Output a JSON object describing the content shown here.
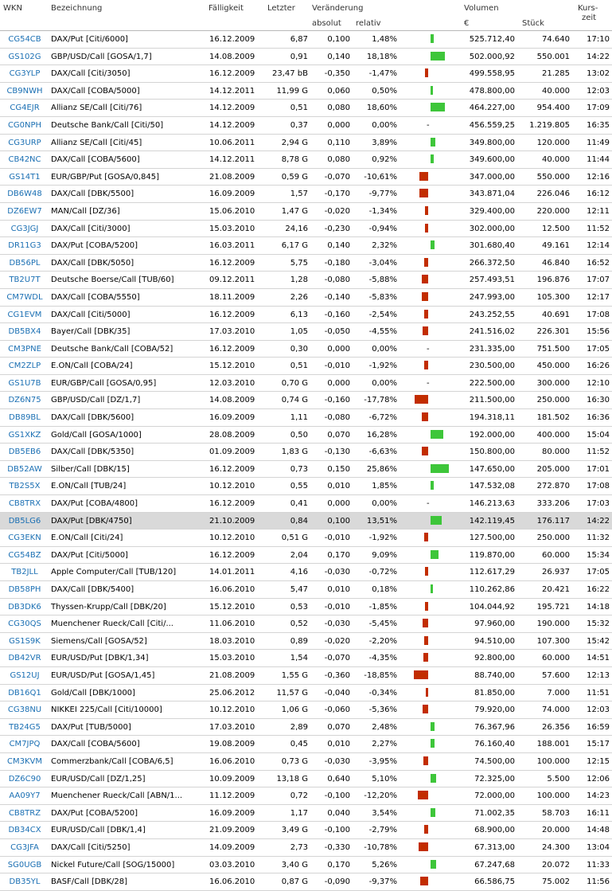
{
  "header": {
    "wkn": "WKN",
    "name": "Bezeichnung",
    "maturity": "Fälligkeit",
    "last": "Letzter",
    "change": "Veränderung",
    "absolute": "absolut",
    "relative": "relativ",
    "volume": "Volumen",
    "volume_unit": "€",
    "pieces": "Stück",
    "time_line1": "Kurs-",
    "time_line2": "zeit"
  },
  "colors": {
    "positive": "#3ec63a",
    "negative": "#c22d00",
    "link": "#1a6fb3",
    "highlight": "#d9d9d9"
  },
  "rows": [
    {
      "wkn": "CG54CB",
      "name": "DAX/Put [Citi/6000]",
      "maturity": "16.12.2009",
      "last": "6,87",
      "abs": "0,100",
      "rel": "1,48%",
      "change_pct": 1.48,
      "volume": "525.712,40",
      "qty": "74.640",
      "time": "17:10"
    },
    {
      "wkn": "GS102G",
      "name": "GBP/USD/Call [GOSA/1,7]",
      "maturity": "14.08.2009",
      "last": "0,91",
      "abs": "0,140",
      "rel": "18,18%",
      "change_pct": 18.18,
      "volume": "502.000,92",
      "qty": "550.001",
      "time": "14:22"
    },
    {
      "wkn": "CG3YLP",
      "name": "DAX/Call [Citi/3050]",
      "maturity": "16.12.2009",
      "last": "23,47 bB",
      "abs": "-0,350",
      "rel": "-1,47%",
      "change_pct": -1.47,
      "volume": "499.558,95",
      "qty": "21.285",
      "time": "13:02"
    },
    {
      "wkn": "CB9NWH",
      "name": "DAX/Call [COBA/5000]",
      "maturity": "14.12.2011",
      "last": "11,99 G",
      "abs": "0,060",
      "rel": "0,50%",
      "change_pct": 0.5,
      "volume": "478.800,00",
      "qty": "40.000",
      "time": "12:03"
    },
    {
      "wkn": "CG4EJR",
      "name": "Allianz SE/Call [Citi/76]",
      "maturity": "14.12.2009",
      "last": "0,51",
      "abs": "0,080",
      "rel": "18,60%",
      "change_pct": 18.6,
      "volume": "464.227,00",
      "qty": "954.400",
      "time": "17:09"
    },
    {
      "wkn": "CG0NPH",
      "name": "Deutsche Bank/Call [Citi/50]",
      "maturity": "14.12.2009",
      "last": "0,37",
      "abs": "0,000",
      "rel": "0,00%",
      "change_pct": 0,
      "volume": "456.559,25",
      "qty": "1.219.805",
      "time": "16:35"
    },
    {
      "wkn": "CG3URP",
      "name": "Allianz SE/Call [Citi/45]",
      "maturity": "10.06.2011",
      "last": "2,94 G",
      "abs": "0,110",
      "rel": "3,89%",
      "change_pct": 3.89,
      "volume": "349.800,00",
      "qty": "120.000",
      "time": "11:49"
    },
    {
      "wkn": "CB42NC",
      "name": "DAX/Call [COBA/5600]",
      "maturity": "14.12.2011",
      "last": "8,78 G",
      "abs": "0,080",
      "rel": "0,92%",
      "change_pct": 0.92,
      "volume": "349.600,00",
      "qty": "40.000",
      "time": "11:44"
    },
    {
      "wkn": "GS14T1",
      "name": "EUR/GBP/Put [GOSA/0,845]",
      "maturity": "21.08.2009",
      "last": "0,59 G",
      "abs": "-0,070",
      "rel": "-10,61%",
      "change_pct": -10.61,
      "volume": "347.000,00",
      "qty": "550.000",
      "time": "12:16"
    },
    {
      "wkn": "DB6W48",
      "name": "DAX/Call [DBK/5500]",
      "maturity": "16.09.2009",
      "last": "1,57",
      "abs": "-0,170",
      "rel": "-9,77%",
      "change_pct": -9.77,
      "volume": "343.871,04",
      "qty": "226.046",
      "time": "16:12"
    },
    {
      "wkn": "DZ6EW7",
      "name": "MAN/Call [DZ/36]",
      "maturity": "15.06.2010",
      "last": "1,47 G",
      "abs": "-0,020",
      "rel": "-1,34%",
      "change_pct": -1.34,
      "volume": "329.400,00",
      "qty": "220.000",
      "time": "12:11"
    },
    {
      "wkn": "CG3JGJ",
      "name": "DAX/Call [Citi/3000]",
      "maturity": "15.03.2010",
      "last": "24,16",
      "abs": "-0,230",
      "rel": "-0,94%",
      "change_pct": -0.94,
      "volume": "302.000,00",
      "qty": "12.500",
      "time": "11:52"
    },
    {
      "wkn": "DR11G3",
      "name": "DAX/Put [COBA/5200]",
      "maturity": "16.03.2011",
      "last": "6,17 G",
      "abs": "0,140",
      "rel": "2,32%",
      "change_pct": 2.32,
      "volume": "301.680,40",
      "qty": "49.161",
      "time": "12:14"
    },
    {
      "wkn": "DB56PL",
      "name": "DAX/Call [DBK/5050]",
      "maturity": "16.12.2009",
      "last": "5,75",
      "abs": "-0,180",
      "rel": "-3,04%",
      "change_pct": -3.04,
      "volume": "266.372,50",
      "qty": "46.840",
      "time": "16:52"
    },
    {
      "wkn": "TB2U7T",
      "name": "Deutsche Boerse/Call [TUB/60]",
      "maturity": "09.12.2011",
      "last": "1,28",
      "abs": "-0,080",
      "rel": "-5,88%",
      "change_pct": -5.88,
      "volume": "257.493,51",
      "qty": "196.876",
      "time": "17:07"
    },
    {
      "wkn": "CM7WDL",
      "name": "DAX/Call [COBA/5550]",
      "maturity": "18.11.2009",
      "last": "2,26",
      "abs": "-0,140",
      "rel": "-5,83%",
      "change_pct": -5.83,
      "volume": "247.993,00",
      "qty": "105.300",
      "time": "12:17"
    },
    {
      "wkn": "CG1EVM",
      "name": "DAX/Call [Citi/5000]",
      "maturity": "16.12.2009",
      "last": "6,13",
      "abs": "-0,160",
      "rel": "-2,54%",
      "change_pct": -2.54,
      "volume": "243.252,55",
      "qty": "40.691",
      "time": "17:08"
    },
    {
      "wkn": "DB5BX4",
      "name": "Bayer/Call [DBK/35]",
      "maturity": "17.03.2010",
      "last": "1,05",
      "abs": "-0,050",
      "rel": "-4,55%",
      "change_pct": -4.55,
      "volume": "241.516,02",
      "qty": "226.301",
      "time": "15:56"
    },
    {
      "wkn": "CM3PNE",
      "name": "Deutsche Bank/Call [COBA/52]",
      "maturity": "16.12.2009",
      "last": "0,30",
      "abs": "0,000",
      "rel": "0,00%",
      "change_pct": 0,
      "volume": "231.335,00",
      "qty": "751.500",
      "time": "17:05"
    },
    {
      "wkn": "CM2ZLP",
      "name": "E.ON/Call [COBA/24]",
      "maturity": "15.12.2010",
      "last": "0,51",
      "abs": "-0,010",
      "rel": "-1,92%",
      "change_pct": -1.92,
      "volume": "230.500,00",
      "qty": "450.000",
      "time": "16:26"
    },
    {
      "wkn": "GS1U7B",
      "name": "EUR/GBP/Call [GOSA/0,95]",
      "maturity": "12.03.2010",
      "last": "0,70 G",
      "abs": "0,000",
      "rel": "0,00%",
      "change_pct": 0,
      "volume": "222.500,00",
      "qty": "300.000",
      "time": "12:10"
    },
    {
      "wkn": "DZ6N75",
      "name": "GBP/USD/Call [DZ/1,7]",
      "maturity": "14.08.2009",
      "last": "0,74 G",
      "abs": "-0,160",
      "rel": "-17,78%",
      "change_pct": -17.78,
      "volume": "211.500,00",
      "qty": "250.000",
      "time": "16:30"
    },
    {
      "wkn": "DB89BL",
      "name": "DAX/Call [DBK/5600]",
      "maturity": "16.09.2009",
      "last": "1,11",
      "abs": "-0,080",
      "rel": "-6,72%",
      "change_pct": -6.72,
      "volume": "194.318,11",
      "qty": "181.502",
      "time": "16:36"
    },
    {
      "wkn": "GS1XKZ",
      "name": "Gold/Call [GOSA/1000]",
      "maturity": "28.08.2009",
      "last": "0,50",
      "abs": "0,070",
      "rel": "16,28%",
      "change_pct": 16.28,
      "volume": "192.000,00",
      "qty": "400.000",
      "time": "15:04"
    },
    {
      "wkn": "DB5EB6",
      "name": "DAX/Call [DBK/5350]",
      "maturity": "01.09.2009",
      "last": "1,83 G",
      "abs": "-0,130",
      "rel": "-6,63%",
      "change_pct": -6.63,
      "volume": "150.800,00",
      "qty": "80.000",
      "time": "11:52"
    },
    {
      "wkn": "DB52AW",
      "name": "Silber/Call [DBK/15]",
      "maturity": "16.12.2009",
      "last": "0,73",
      "abs": "0,150",
      "rel": "25,86%",
      "change_pct": 25.86,
      "volume": "147.650,00",
      "qty": "205.000",
      "time": "17:01"
    },
    {
      "wkn": "TB2S5X",
      "name": "E.ON/Call [TUB/24]",
      "maturity": "10.12.2010",
      "last": "0,55",
      "abs": "0,010",
      "rel": "1,85%",
      "change_pct": 1.85,
      "volume": "147.532,08",
      "qty": "272.870",
      "time": "17:08"
    },
    {
      "wkn": "CB8TRX",
      "name": "DAX/Put [COBA/4800]",
      "maturity": "16.12.2009",
      "last": "0,41",
      "abs": "0,000",
      "rel": "0,00%",
      "change_pct": 0,
      "volume": "146.213,63",
      "qty": "333.206",
      "time": "17:03"
    },
    {
      "wkn": "DB5LG6",
      "name": "DAX/Put [DBK/4750]",
      "maturity": "21.10.2009",
      "last": "0,84",
      "abs": "0,100",
      "rel": "13,51%",
      "change_pct": 13.51,
      "volume": "142.119,45",
      "qty": "176.117",
      "time": "14:22",
      "highlight": true
    },
    {
      "wkn": "CG3EKN",
      "name": "E.ON/Call [Citi/24]",
      "maturity": "10.12.2010",
      "last": "0,51 G",
      "abs": "-0,010",
      "rel": "-1,92%",
      "change_pct": -1.92,
      "volume": "127.500,00",
      "qty": "250.000",
      "time": "11:32"
    },
    {
      "wkn": "CG54BZ",
      "name": "DAX/Put [Citi/5000]",
      "maturity": "16.12.2009",
      "last": "2,04",
      "abs": "0,170",
      "rel": "9,09%",
      "change_pct": 9.09,
      "volume": "119.870,00",
      "qty": "60.000",
      "time": "15:34"
    },
    {
      "wkn": "TB2JLL",
      "name": "Apple Computer/Call [TUB/120]",
      "maturity": "14.01.2011",
      "last": "4,16",
      "abs": "-0,030",
      "rel": "-0,72%",
      "change_pct": -0.72,
      "volume": "112.617,29",
      "qty": "26.937",
      "time": "17:05"
    },
    {
      "wkn": "DB58PH",
      "name": "DAX/Call [DBK/5400]",
      "maturity": "16.06.2010",
      "last": "5,47",
      "abs": "0,010",
      "rel": "0,18%",
      "change_pct": 0.18,
      "volume": "110.262,86",
      "qty": "20.421",
      "time": "16:22"
    },
    {
      "wkn": "DB3DK6",
      "name": "Thyssen-Krupp/Call [DBK/20]",
      "maturity": "15.12.2010",
      "last": "0,53",
      "abs": "-0,010",
      "rel": "-1,85%",
      "change_pct": -1.85,
      "volume": "104.044,92",
      "qty": "195.721",
      "time": "14:18"
    },
    {
      "wkn": "CG30QS",
      "name": "Muenchener Rueck/Call [Citi/...",
      "maturity": "11.06.2010",
      "last": "0,52",
      "abs": "-0,030",
      "rel": "-5,45%",
      "change_pct": -5.45,
      "volume": "97.960,00",
      "qty": "190.000",
      "time": "15:32"
    },
    {
      "wkn": "GS1S9K",
      "name": "Siemens/Call [GOSA/52]",
      "maturity": "18.03.2010",
      "last": "0,89",
      "abs": "-0,020",
      "rel": "-2,20%",
      "change_pct": -2.2,
      "volume": "94.510,00",
      "qty": "107.300",
      "time": "15:42"
    },
    {
      "wkn": "DB42VR",
      "name": "EUR/USD/Put [DBK/1,34]",
      "maturity": "15.03.2010",
      "last": "1,54",
      "abs": "-0,070",
      "rel": "-4,35%",
      "change_pct": -4.35,
      "volume": "92.800,00",
      "qty": "60.000",
      "time": "14:51"
    },
    {
      "wkn": "GS12UJ",
      "name": "EUR/USD/Put [GOSA/1,45]",
      "maturity": "21.08.2009",
      "last": "1,55 G",
      "abs": "-0,360",
      "rel": "-18,85%",
      "change_pct": -18.85,
      "volume": "88.740,00",
      "qty": "57.600",
      "time": "12:13"
    },
    {
      "wkn": "DB16Q1",
      "name": "Gold/Call [DBK/1000]",
      "maturity": "25.06.2012",
      "last": "11,57 G",
      "abs": "-0,040",
      "rel": "-0,34%",
      "change_pct": -0.34,
      "volume": "81.850,00",
      "qty": "7.000",
      "time": "11:51"
    },
    {
      "wkn": "CG38NU",
      "name": "NIKKEI 225/Call [Citi/10000]",
      "maturity": "10.12.2010",
      "last": "1,06 G",
      "abs": "-0,060",
      "rel": "-5,36%",
      "change_pct": -5.36,
      "volume": "79.920,00",
      "qty": "74.000",
      "time": "12:03"
    },
    {
      "wkn": "TB24G5",
      "name": "DAX/Put [TUB/5000]",
      "maturity": "17.03.2010",
      "last": "2,89",
      "abs": "0,070",
      "rel": "2,48%",
      "change_pct": 2.48,
      "volume": "76.367,96",
      "qty": "26.356",
      "time": "16:59"
    },
    {
      "wkn": "CM7JPQ",
      "name": "DAX/Call [COBA/5600]",
      "maturity": "19.08.2009",
      "last": "0,45",
      "abs": "0,010",
      "rel": "2,27%",
      "change_pct": 2.27,
      "volume": "76.160,40",
      "qty": "188.001",
      "time": "15:17"
    },
    {
      "wkn": "CM3KVM",
      "name": "Commerzbank/Call [COBA/6,5]",
      "maturity": "16.06.2010",
      "last": "0,73 G",
      "abs": "-0,030",
      "rel": "-3,95%",
      "change_pct": -3.95,
      "volume": "74.500,00",
      "qty": "100.000",
      "time": "12:15"
    },
    {
      "wkn": "DZ6C90",
      "name": "EUR/USD/Call [DZ/1,25]",
      "maturity": "10.09.2009",
      "last": "13,18 G",
      "abs": "0,640",
      "rel": "5,10%",
      "change_pct": 5.1,
      "volume": "72.325,00",
      "qty": "5.500",
      "time": "12:06"
    },
    {
      "wkn": "AA09Y7",
      "name": "Muenchener Rueck/Call [ABN/1...",
      "maturity": "11.12.2009",
      "last": "0,72",
      "abs": "-0,100",
      "rel": "-12,20%",
      "change_pct": -12.2,
      "volume": "72.000,00",
      "qty": "100.000",
      "time": "14:23"
    },
    {
      "wkn": "CB8TRZ",
      "name": "DAX/Put [COBA/5200]",
      "maturity": "16.09.2009",
      "last": "1,17",
      "abs": "0,040",
      "rel": "3,54%",
      "change_pct": 3.54,
      "volume": "71.002,35",
      "qty": "58.703",
      "time": "16:11"
    },
    {
      "wkn": "DB34CX",
      "name": "EUR/USD/Call [DBK/1,4]",
      "maturity": "21.09.2009",
      "last": "3,49 G",
      "abs": "-0,100",
      "rel": "-2,79%",
      "change_pct": -2.79,
      "volume": "68.900,00",
      "qty": "20.000",
      "time": "14:48"
    },
    {
      "wkn": "CG3JFA",
      "name": "DAX/Call [Citi/5250]",
      "maturity": "14.09.2009",
      "last": "2,73",
      "abs": "-0,330",
      "rel": "-10,78%",
      "change_pct": -10.78,
      "volume": "67.313,00",
      "qty": "24.300",
      "time": "13:04"
    },
    {
      "wkn": "SG0UGB",
      "name": "Nickel Future/Call [SOG/15000]",
      "maturity": "03.03.2010",
      "last": "3,40 G",
      "abs": "0,170",
      "rel": "5,26%",
      "change_pct": 5.26,
      "volume": "67.247,68",
      "qty": "20.072",
      "time": "11:33"
    },
    {
      "wkn": "DB35YL",
      "name": "BASF/Call [DBK/28]",
      "maturity": "16.06.2010",
      "last": "0,87 G",
      "abs": "-0,090",
      "rel": "-9,37%",
      "change_pct": -9.37,
      "volume": "66.586,75",
      "qty": "75.002",
      "time": "11:56"
    }
  ]
}
